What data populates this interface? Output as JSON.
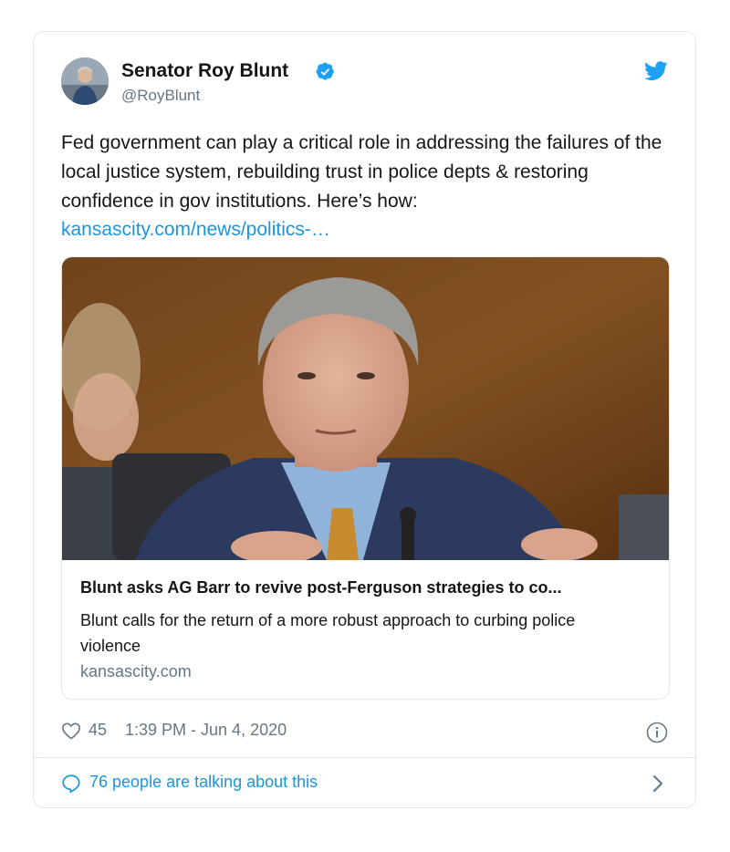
{
  "author": {
    "display_name": "Senator Roy Blunt",
    "handle": "@RoyBlunt",
    "verified": true
  },
  "tweet": {
    "text": "Fed government can play a critical role in addressing the failures of the local justice system, rebuilding trust in police depts & restoring confidence in gov institutions. Here’s how:",
    "link_text": "kansascity.com/news/politics-…"
  },
  "link_card": {
    "title": "Blunt asks AG Barr to revive post-Ferguson strategies to co...",
    "description": "Blunt calls for the return of a more robust approach to curbing police violence",
    "domain": "kansascity.com"
  },
  "footer": {
    "likes": "45",
    "timestamp": "1:39 PM - Jun 4, 2020",
    "talking": "76 people are talking about this"
  },
  "colors": {
    "link": "#1b95e0",
    "muted": "#657786",
    "border": "#e1e8ed",
    "verified": "#1da1f2"
  },
  "icons": [
    "verified-badge-icon",
    "twitter-bird-icon",
    "heart-icon",
    "info-icon",
    "speech-bubble-icon",
    "chevron-right-icon"
  ]
}
